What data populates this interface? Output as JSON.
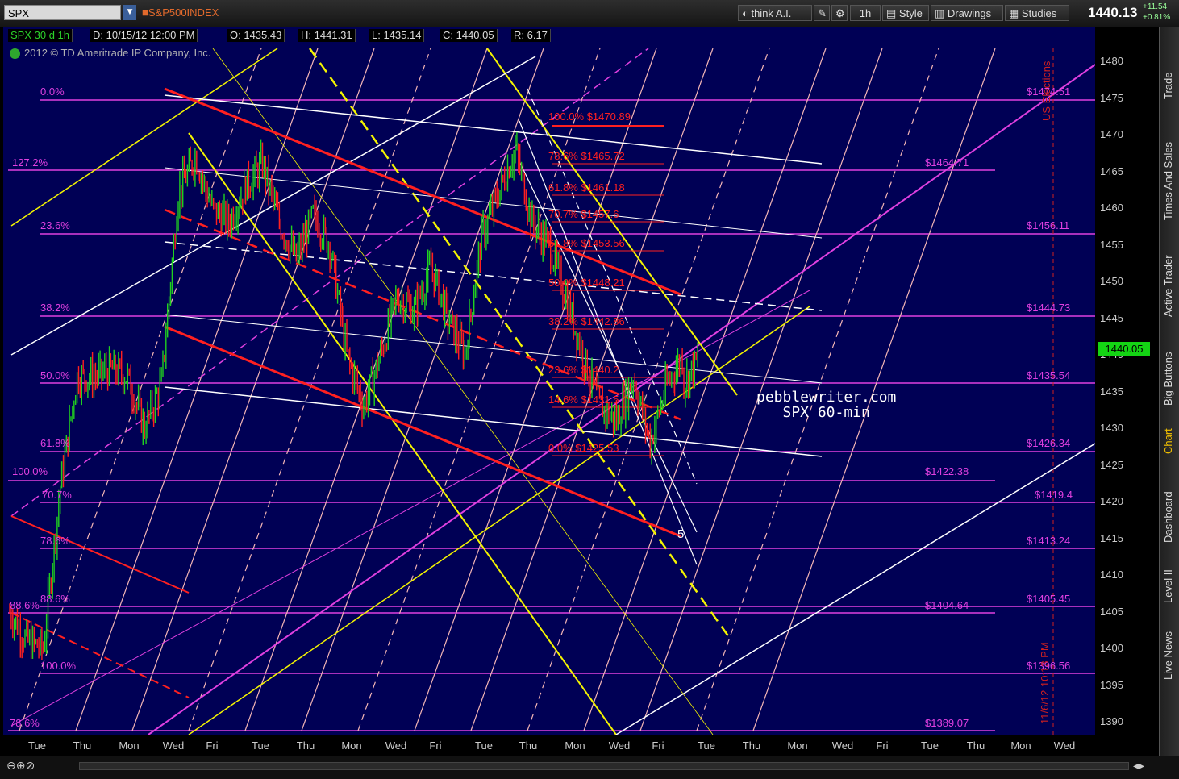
{
  "toolbar": {
    "symbol": "SPX",
    "index_name": "S&P500INDEX",
    "think_ai": "think A.I.",
    "timeframe": "1h",
    "style": "Style",
    "drawings": "Drawings",
    "studies": "Studies",
    "last_price": "1440.13",
    "change_abs": "+11.54",
    "change_pct": "+0.81%"
  },
  "info": {
    "chart_label": "SPX 30 d 1h",
    "date": "D: 10/15/12 12:00 PM",
    "open": "O: 1435.43",
    "high": "H: 1441.31",
    "low": "L: 1435.14",
    "close": "C: 1440.05",
    "range": "R: 6.17",
    "copyright": "2012 © TD Ameritrade IP Company, Inc."
  },
  "price_badge": "1440.05",
  "watermark": {
    "line1": "pebblewriter.com",
    "line2": "SPX 60-min"
  },
  "wave_label": "5",
  "annotations": {
    "us_elections": "US Elections",
    "elect_date": "11/6/12 10:13 PM"
  },
  "sidebar_tabs": [
    "Trade",
    "Times And Sales",
    "Active Trader",
    "Big Buttons",
    "Chart",
    "Dashboard",
    "Level II",
    "Live News"
  ],
  "price_ticks": [
    "1480",
    "1475",
    "1470",
    "1465",
    "1460",
    "1455",
    "1450",
    "1445",
    "1440",
    "1435",
    "1430",
    "1425",
    "1420",
    "1415",
    "1410",
    "1405",
    "1400",
    "1395",
    "1390"
  ],
  "time_ticks": [
    "Tue",
    "Thu",
    "Mon",
    "Wed",
    "Fri",
    "Tue",
    "Thu",
    "Mon",
    "Wed",
    "Fri",
    "Tue",
    "Thu",
    "Mon",
    "Wed",
    "Fri",
    "Tue",
    "Thu",
    "Mon",
    "Wed",
    "Fri",
    "Tue",
    "Thu",
    "Mon",
    "Wed"
  ],
  "left_fibs": [
    "0.0%",
    "127.2%",
    "23.6%",
    "38.2%",
    "50.0%",
    "61.8%",
    "100.0%",
    "70.7%",
    "78.6%",
    "88.6%",
    "88.6%",
    "100.0%",
    "78.6%"
  ],
  "right_levels": [
    "$1474.51",
    "$1464.71",
    "$1456.11",
    "$1444.73",
    "$1435.54",
    "$1426.34",
    "$1422.38",
    "$1419.4",
    "$1413.24",
    "$1404.64",
    "$1405.45",
    "$1396.56",
    "$1389.07"
  ],
  "red_fibs": [
    "100.0%  $1470.89",
    "78.6%  $1465.72",
    "61.8%  $1461.18",
    "70.7%  $1457.6",
    "61.8%  $1453.56",
    "50.0%  $1448.21",
    "38.2%  $1442.86",
    "23.6%  $1440.2",
    "14.6%  $1431.5",
    "0.0%  $1425.53"
  ],
  "colors": {
    "chart_bg": "#000055",
    "magenta": "#e040e0",
    "red": "#ff2020",
    "yellow": "#f5f500",
    "green_candle": "#20d020",
    "red_candle": "#ff2020"
  }
}
